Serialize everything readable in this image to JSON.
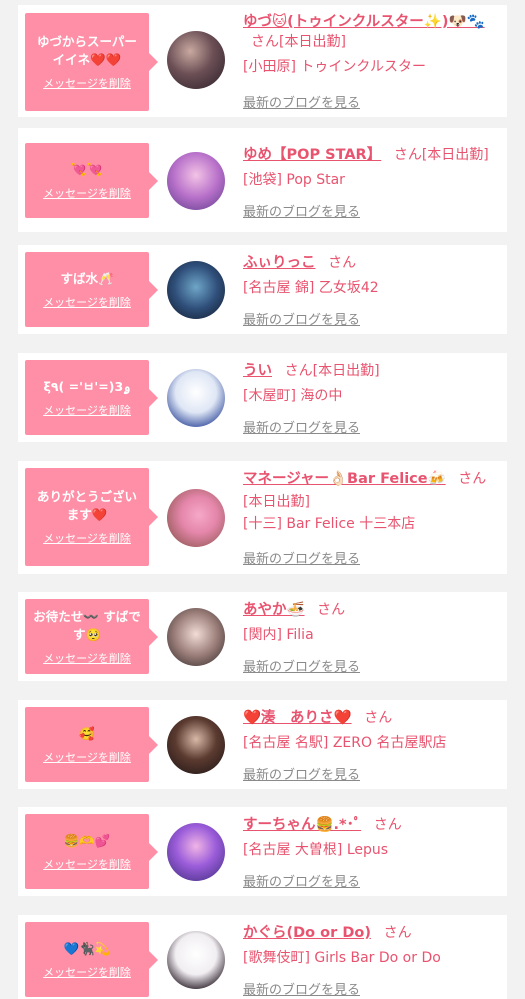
{
  "common": {
    "delete_label": "メッセージを削除",
    "san": "さん",
    "blog_label": "最新のブログを見る"
  },
  "cards": [
    {
      "message": "ゆづからスーパーイイネ❤️❤️",
      "name": "ゆづ🐱(トゥインクルスター✨)🐶🐾",
      "shift": "[本日出勤]",
      "shop": "[小田原] トゥインクルスター"
    },
    {
      "message": "💘💘",
      "name": "ゆめ【POP STAR】",
      "shift": "[本日出勤]",
      "shop": "[池袋] Pop Star"
    },
    {
      "message": "すば水🥂",
      "name": "ふぃりっこ",
      "shift": "",
      "shop": "[名古屋 錦] 乙女坂42"
    },
    {
      "message": "ξ٩( ='ㅂ'=)ۄ3",
      "name": "うい",
      "shift": "[本日出勤]",
      "shop": "[木屋町] 海の中"
    },
    {
      "message": "ありがとうございます❤️",
      "name": "マネージャー👌🏻Bar Felice🍻",
      "shift": "[本日出勤]",
      "shop": "[十三] Bar Felice 十三本店"
    },
    {
      "message": "お待たせ〰️ すばです🥺",
      "name": "あやか🍜",
      "shift": "",
      "shop": "[関内] Filia"
    },
    {
      "message": "🥰",
      "name": "❤️湊　ありさ❤️",
      "shift": "",
      "shop": "[名古屋 名駅] ZERO 名古屋駅店"
    },
    {
      "message": "🍔🫶💕",
      "name": "すーちゃん🍔.*･ﾟ",
      "shift": "",
      "shop": "[名古屋 大曽根] Lepus"
    },
    {
      "message": "💙🐈‍⬛💫",
      "name": "かぐら(Do or Do)",
      "shift": "",
      "shop": "[歌舞伎町] Girls Bar Do or Do"
    }
  ]
}
